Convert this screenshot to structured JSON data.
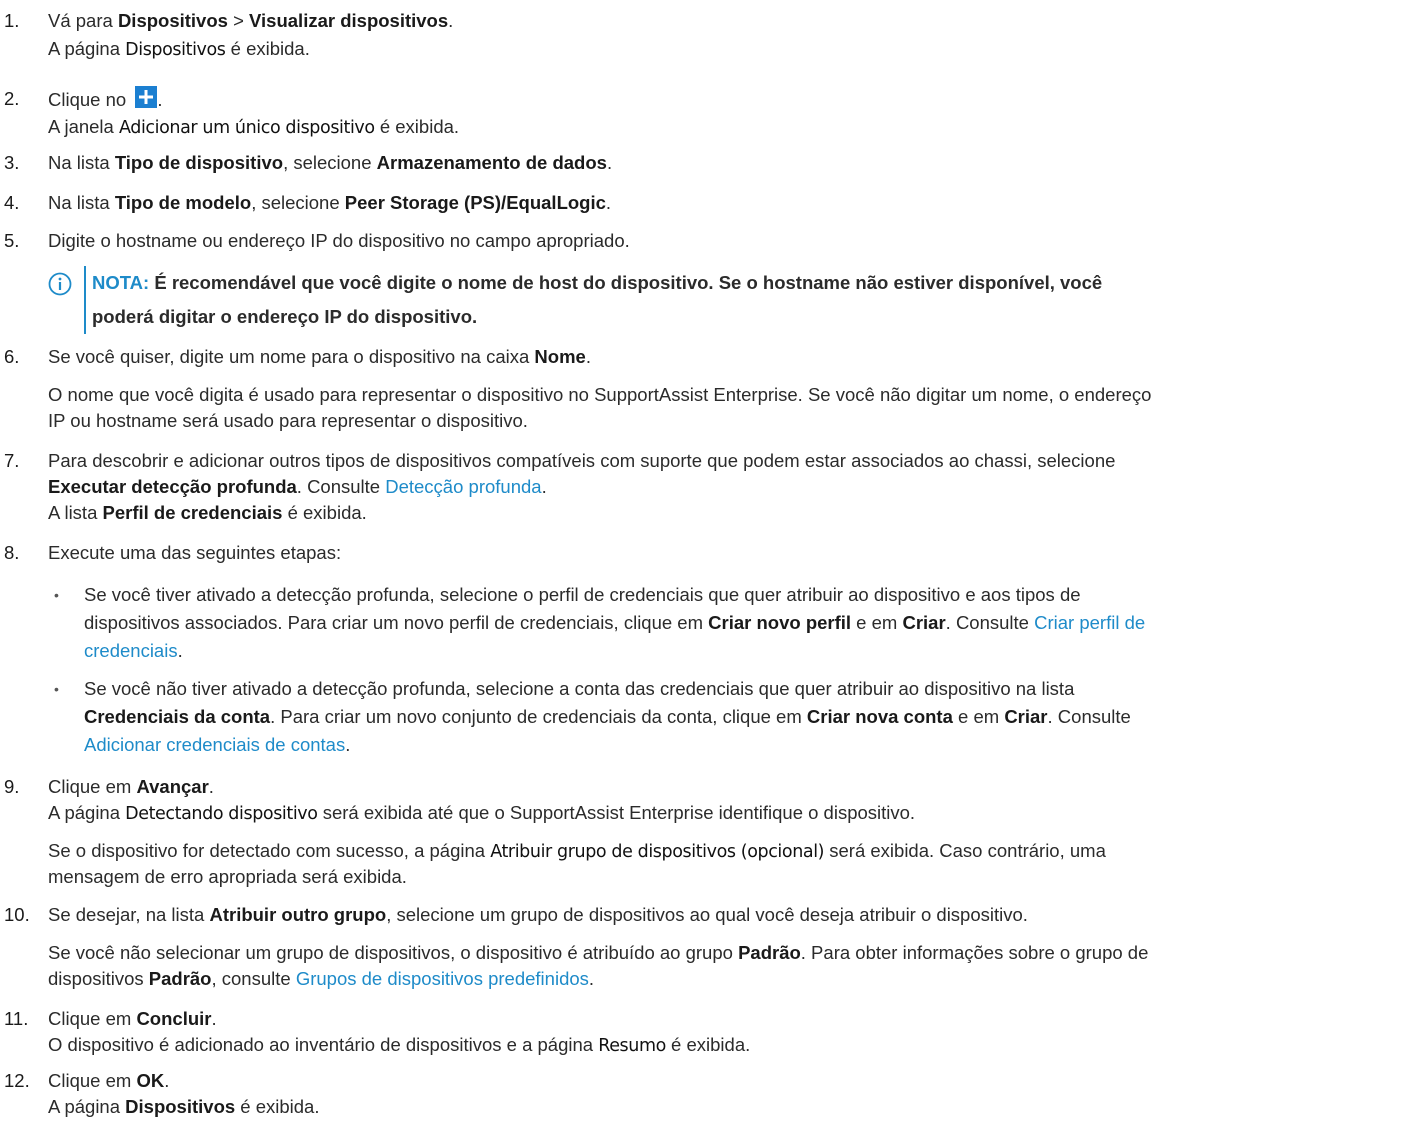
{
  "steps": {
    "s1": {
      "num": "1.",
      "pre": "Vá para ",
      "b1": "Dispositivos",
      "mid": " > ",
      "b2": "Visualizar dispositivos",
      "post": ".",
      "r_pre": "A página ",
      "r_ui": "Dispositivos",
      "r_post": " é exibida."
    },
    "s2": {
      "num": "2.",
      "pre": "Clique no ",
      "post": ".",
      "r_pre": "A janela ",
      "r_ui": "Adicionar um único dispositivo",
      "r_post": " é exibida."
    },
    "s3": {
      "num": "3.",
      "pre": "Na lista ",
      "b1": "Tipo de dispositivo",
      "mid": ", selecione ",
      "b2": "Armazenamento de dados",
      "post": "."
    },
    "s4": {
      "num": "4.",
      "pre": "Na lista ",
      "b1": "Tipo de modelo",
      "mid": ", selecione ",
      "b2": "Peer Storage (PS)/EqualLogic",
      "post": "."
    },
    "s5": {
      "num": "5.",
      "text": "Digite o hostname ou endereço IP do dispositivo no campo apropriado."
    },
    "note": {
      "label": "NOTA:",
      "line1": " É recomendável que você digite o nome de host do dispositivo. Se o hostname não estiver disponível, você",
      "line2": "poderá digitar o endereço IP do dispositivo."
    },
    "s6": {
      "num": "6.",
      "pre": "Se você quiser, digite um nome para o dispositivo na caixa ",
      "b1": "Nome",
      "post": ".",
      "p1": "O nome que você digita é usado para representar o dispositivo no SupportAssist Enterprise. Se você não digitar um nome, o endereço",
      "p2": "IP ou hostname será usado para representar o dispositivo."
    },
    "s7": {
      "num": "7.",
      "l1": "Para descobrir e adicionar outros tipos de dispositivos compatíveis com suporte que podem estar associados ao chassi, selecione",
      "b1": "Executar detecção profunda",
      "mid": ". Consulte ",
      "link": "Detecção profunda",
      "post": ".",
      "r_pre": "A lista ",
      "r_b": "Perfil de credenciais",
      "r_post": " é exibida."
    },
    "s8": {
      "num": "8.",
      "text": "Execute uma das seguintes etapas:",
      "bullet1": {
        "l1": "Se você tiver ativado a detecção profunda, selecione o perfil de credenciais que quer atribuir ao dispositivo e aos tipos de",
        "l2_pre": "dispositivos associados. Para criar um novo perfil de credenciais, clique em ",
        "b1": "Criar novo perfil",
        "mid": " e em ",
        "b2": "Criar",
        "l2_post": ". Consulte ",
        "link_a": "Criar perfil de",
        "link_b": "credenciais",
        "end": "."
      },
      "bullet2": {
        "l1": "Se você não tiver ativado a detecção profunda, selecione a conta das credenciais que quer atribuir ao dispositivo na lista",
        "b0": "Credenciais da conta",
        "l2_pre": ". Para criar um novo conjunto de credenciais da conta, clique em ",
        "b1": "Criar nova conta",
        "mid": " e em ",
        "b2": "Criar",
        "l2_post": ". Consulte",
        "link": "Adicionar credenciais de contas",
        "end": "."
      }
    },
    "s9": {
      "num": "9.",
      "pre": "Clique em ",
      "b1": "Avançar",
      "post": ".",
      "r_pre": "A página ",
      "r_ui": "Detectando dispositivo",
      "r_post": " será exibida até que o SupportAssist Enterprise identifique o dispositivo.",
      "p_pre": "Se o dispositivo for detectado com sucesso, a página ",
      "p_ui": "Atribuir grupo de dispositivos (opcional)",
      "p_post": " será exibida. Caso contrário, uma",
      "p2": "mensagem de erro apropriada será exibida."
    },
    "s10": {
      "num": "10.",
      "pre": "Se desejar, na lista ",
      "b1": "Atribuir outro grupo",
      "post": ", selecione um grupo de dispositivos ao qual você deseja atribuir o dispositivo.",
      "p_pre": "Se você não selecionar um grupo de dispositivos, o dispositivo é atribuído ao grupo ",
      "p_b": "Padrão",
      "p_post": ". Para obter informações sobre o grupo de",
      "p2_pre": "dispositivos ",
      "p2_b": "Padrão",
      "p2_mid": ", consulte ",
      "p2_link": "Grupos de dispositivos predefinidos",
      "p2_post": "."
    },
    "s11": {
      "num": "11.",
      "pre": "Clique em ",
      "b1": "Concluir",
      "post": ".",
      "r_pre": "O dispositivo é adicionado ao inventário de dispositivos e a página ",
      "r_ui": "Resumo",
      "r_post": " é exibida."
    },
    "s12": {
      "num": "12.",
      "pre": "Clique em ",
      "b1": "OK",
      "post": ".",
      "r_pre": "A página ",
      "r_b": "Dispositivos",
      "r_post": " é exibida."
    }
  },
  "icons": {
    "info": "info-circle-icon",
    "add": "add-plus-icon"
  },
  "colors": {
    "link": "#1e8bc9",
    "add_icon": "#1b7fd1"
  }
}
